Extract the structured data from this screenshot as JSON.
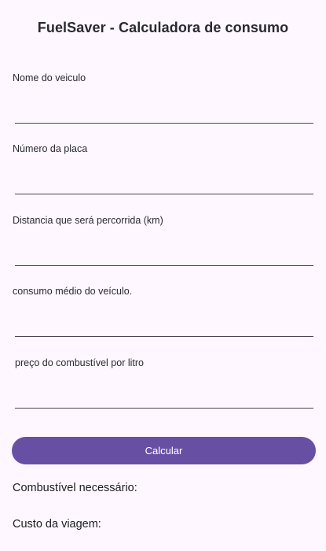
{
  "app": {
    "title": "FuelSaver - Calculadora de consumo"
  },
  "form": {
    "vehicle_name": {
      "label": "Nome do veiculo",
      "value": ""
    },
    "plate": {
      "label": "Número da placa",
      "value": ""
    },
    "distance": {
      "label": "Distancia que será percorrida (km)",
      "value": ""
    },
    "consumption": {
      "label": "consumo médio do veículo.",
      "value": ""
    },
    "fuel_price": {
      "label": "preço do combustível por litro",
      "value": ""
    }
  },
  "actions": {
    "calculate_label": "Calcular"
  },
  "results": {
    "fuel_needed_label": "Combustível necessário:",
    "trip_cost_label": "Custo da viagem:"
  },
  "colors": {
    "background": "#fef7ff",
    "primary": "#6750a4",
    "text": "#1d1b20",
    "underline": "#4a4458"
  }
}
